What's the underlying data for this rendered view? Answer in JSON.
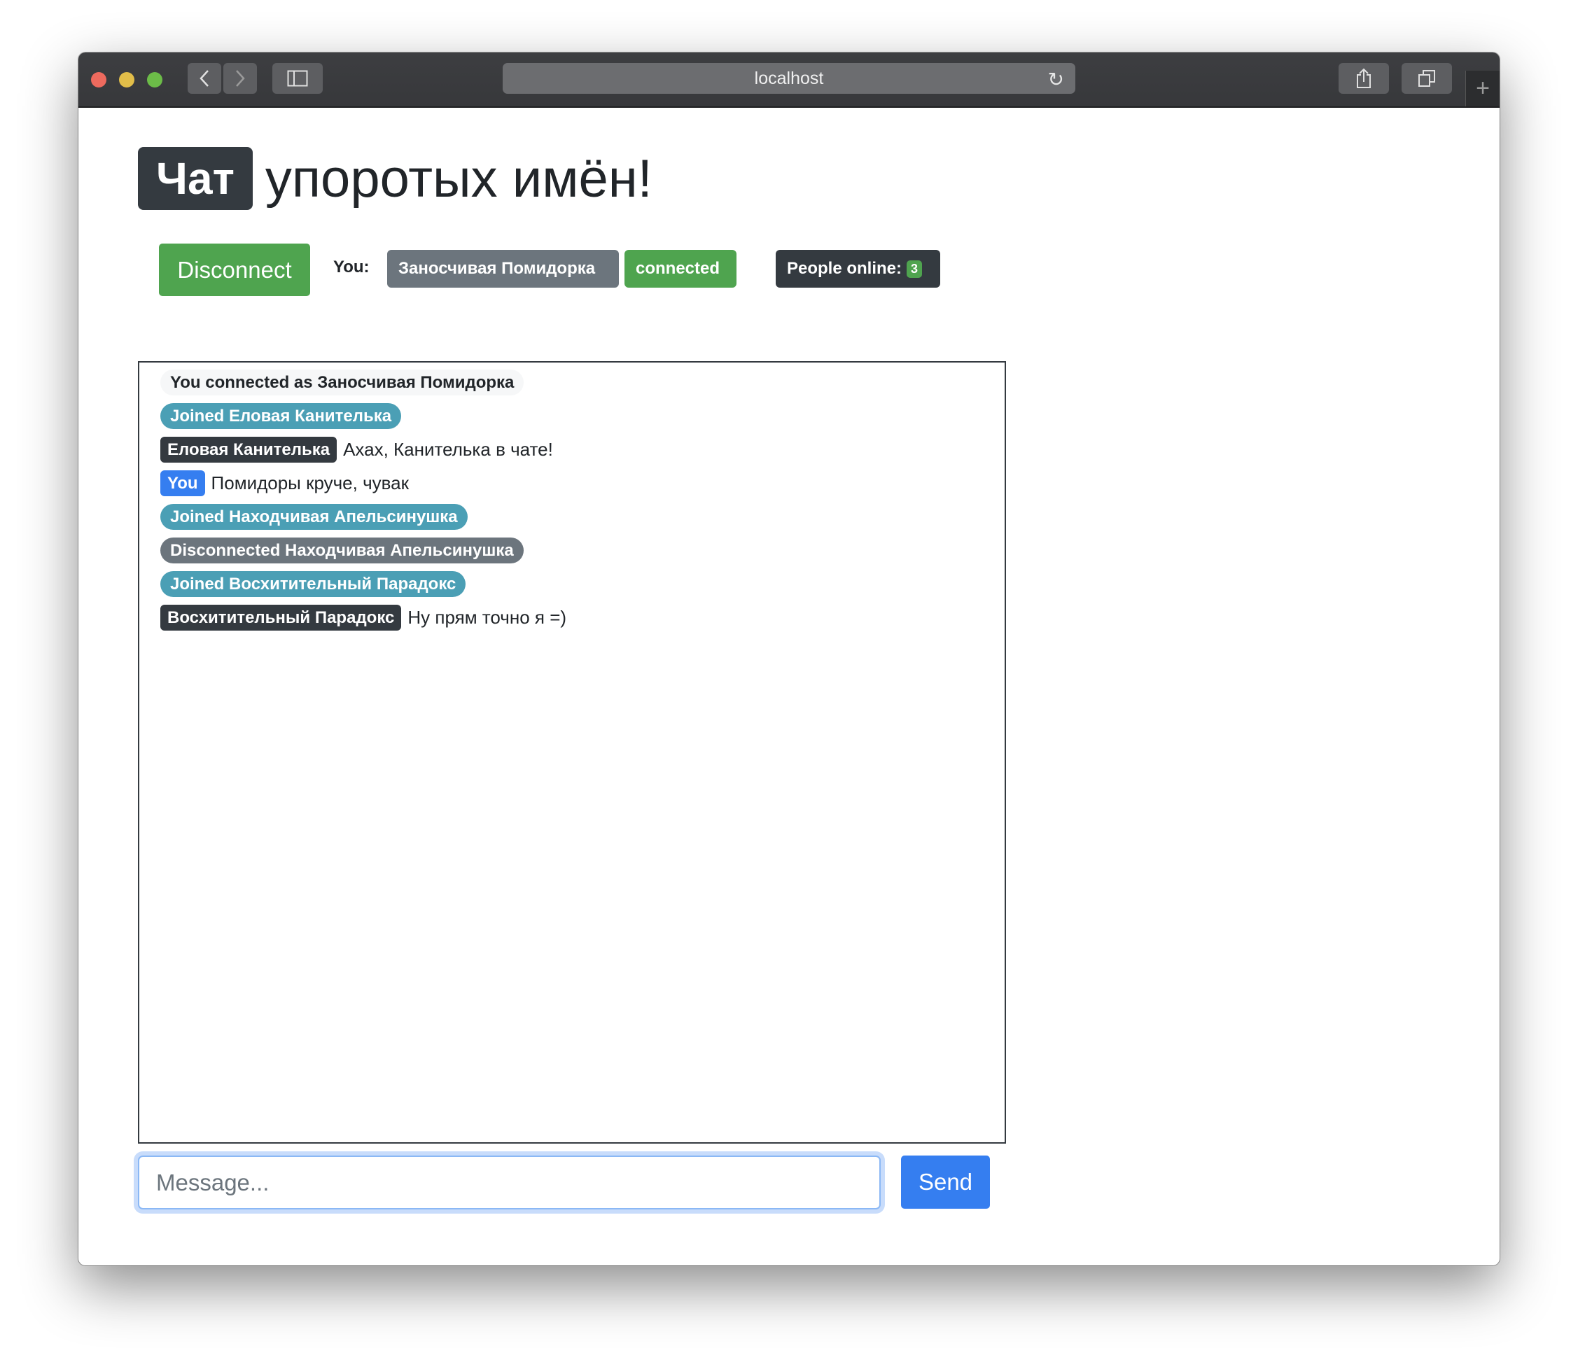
{
  "browser": {
    "url": "localhost",
    "traffic_lights": {
      "close": "#ee6a5e",
      "minimize": "#e1bd49",
      "maximize": "#6cbc48"
    },
    "icons": [
      "back-icon",
      "forward-icon",
      "sidebar-icon",
      "reload-icon",
      "share-icon",
      "tabs-icon",
      "new-tab-icon"
    ]
  },
  "header": {
    "badge": "Чат",
    "title": "упоротых имён!"
  },
  "status_bar": {
    "disconnect_label": "Disconnect",
    "you_label": "You:",
    "username": "Заносчивая Помидорка",
    "connection_status": "connected",
    "people_online_label": "People online:",
    "people_online_count": "3"
  },
  "messages": [
    {
      "type": "system",
      "text": "You connected as Заносчивая Помидорка"
    },
    {
      "type": "joined",
      "text": "Joined Еловая Канителька"
    },
    {
      "type": "chat",
      "author": "Еловая Канителька",
      "text": "Ахах, Канителька в чате!"
    },
    {
      "type": "self",
      "author": "You",
      "text": "Помидоры круче, чувак"
    },
    {
      "type": "joined",
      "text": "Joined Находчивая Апельсинушка"
    },
    {
      "type": "left",
      "text": "Disconnected Находчивая Апельсинушка"
    },
    {
      "type": "joined",
      "text": "Joined Восхитительный Парадокс"
    },
    {
      "type": "chat",
      "author": "Восхитительный Парадокс",
      "text": "Ну прям точно я =)"
    }
  ],
  "composer": {
    "placeholder": "Message...",
    "value": "",
    "send_label": "Send"
  },
  "colors": {
    "success": "#4fa44f",
    "secondary": "#6c757d",
    "dark": "#343a40",
    "info": "#4b9fb5",
    "primary": "#357ef0",
    "light": "#f6f7f8"
  }
}
